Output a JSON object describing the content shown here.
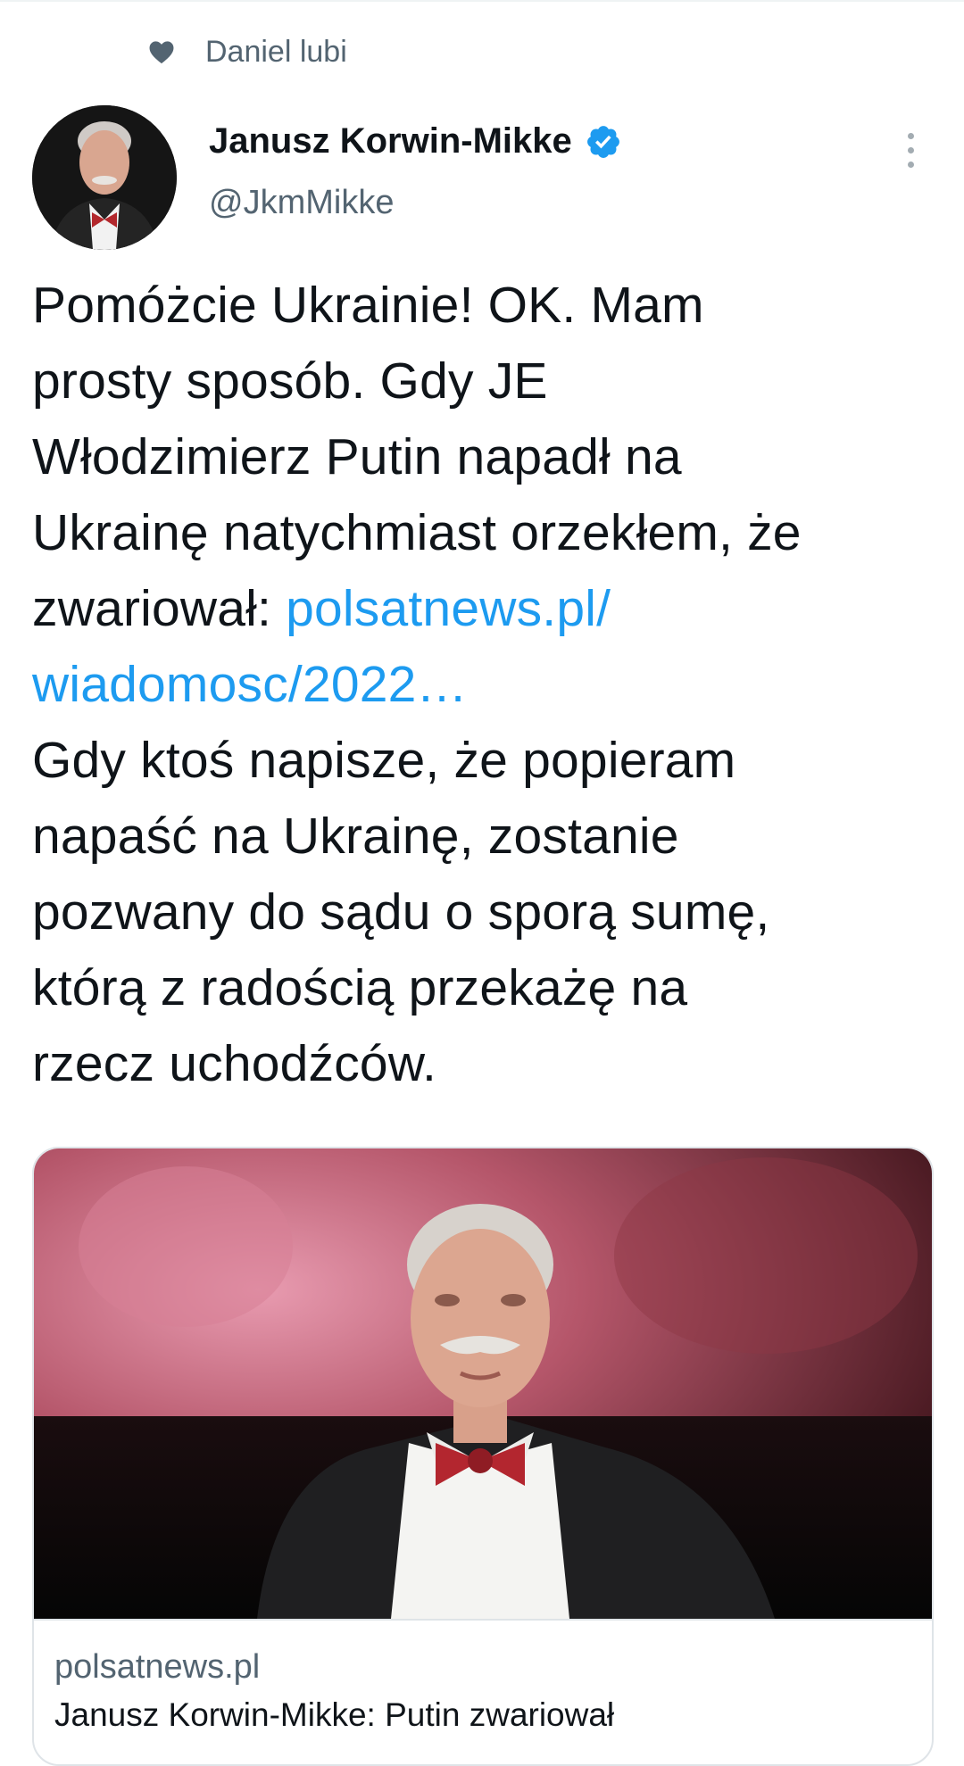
{
  "social_context": {
    "icon": "heart-icon",
    "text": "Daniel lubi"
  },
  "author": {
    "name": "Janusz Korwin-Mikke",
    "verified": true,
    "handle": "@JkmMikke"
  },
  "tweet": {
    "lines": [
      "Pomóżcie Ukrainie! OK. Mam",
      "prosty sposób. Gdy JE",
      "Włodzimierz Putin napadł na",
      "Ukrainę natychmiast orzekłem, że"
    ],
    "link_prefix": "zwariował: ",
    "link_part1": "polsatnews.pl/",
    "link_part2": "wiadomosc/2022…",
    "lines_after": [
      "Gdy ktoś napisze, że popieram",
      "napaść na Ukrainę, zostanie",
      "pozwany do sądu o sporą sumę,",
      "którą z radością przekażę na",
      "rzecz uchodźców."
    ]
  },
  "card": {
    "domain": "polsatnews.pl",
    "title": "Janusz Korwin-Mikke: Putin zwariował"
  },
  "colors": {
    "text": "#0f1419",
    "secondary": "#536471",
    "link": "#1d9bf0",
    "border": "#dfe4e8"
  }
}
